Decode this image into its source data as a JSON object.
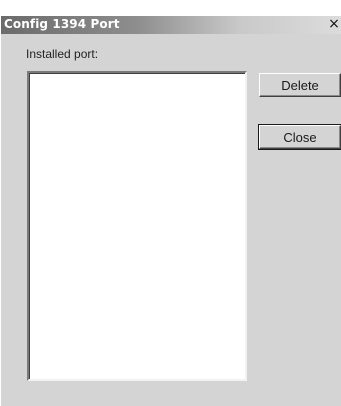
{
  "window": {
    "title": "Config 1394 Port",
    "close_glyph": "×"
  },
  "main": {
    "installed_port_label": "Installed port:",
    "installed_ports": []
  },
  "buttons": {
    "delete_label": "Delete",
    "close_label": "Close"
  },
  "icons": {
    "title_close": "close-icon"
  },
  "colors": {
    "dialog_background": "#d4d4d4",
    "title_gradient_start": "#6b6b6b",
    "title_gradient_end": "#dcdcdc",
    "list_background": "#ffffff"
  }
}
